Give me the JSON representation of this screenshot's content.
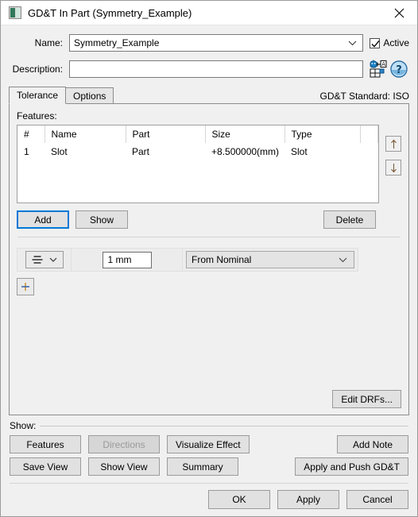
{
  "window": {
    "title": "GD&T In Part (Symmetry_Example)",
    "icon": "part-icon",
    "close_icon": "close-icon"
  },
  "form": {
    "name_label": "Name:",
    "name_value": "Symmetry_Example",
    "active_label": "Active",
    "active_checked": true,
    "description_label": "Description:",
    "description_value": "",
    "datum_icon": "gdt-datum-icon",
    "help_icon": "help-icon"
  },
  "tabs": [
    {
      "label": "Tolerance",
      "active": true
    },
    {
      "label": "Options",
      "active": false
    }
  ],
  "standard_label": "GD&T Standard: ISO",
  "features": {
    "label": "Features:",
    "columns": [
      "#",
      "Name",
      "Part",
      "Size",
      "Type"
    ],
    "rows": [
      {
        "num": "1",
        "name": "Slot",
        "part": "Part",
        "size": "+8.500000(mm)",
        "type": "Slot"
      }
    ],
    "move_up_icon": "arrow-up-icon",
    "move_down_icon": "arrow-down-icon",
    "add_label": "Add",
    "show_label": "Show",
    "delete_label": "Delete"
  },
  "tolerance_row": {
    "symbol": "symmetry-symbol",
    "value": "1 mm",
    "mode": "From Nominal",
    "add_row_label": "+"
  },
  "edit_drfs_label": "Edit DRFs...",
  "show_group": {
    "title": "Show:",
    "buttons": [
      {
        "label": "Features",
        "disabled": false
      },
      {
        "label": "Directions",
        "disabled": true
      },
      {
        "label": "Visualize Effect",
        "disabled": false
      },
      {
        "label": "Add Note",
        "disabled": false
      },
      {
        "label": "Save View",
        "disabled": false
      },
      {
        "label": "Show View",
        "disabled": false
      },
      {
        "label": "Summary",
        "disabled": false
      },
      {
        "label": "Apply and Push GD&T",
        "disabled": false
      }
    ]
  },
  "dialog_buttons": [
    {
      "label": "OK"
    },
    {
      "label": "Apply"
    },
    {
      "label": "Cancel"
    }
  ],
  "colors": {
    "accent": "#0078d7",
    "window_bg": "#f0f0f0",
    "titlebar_bg": "#ffffff",
    "field_bg": "#ffffff"
  }
}
